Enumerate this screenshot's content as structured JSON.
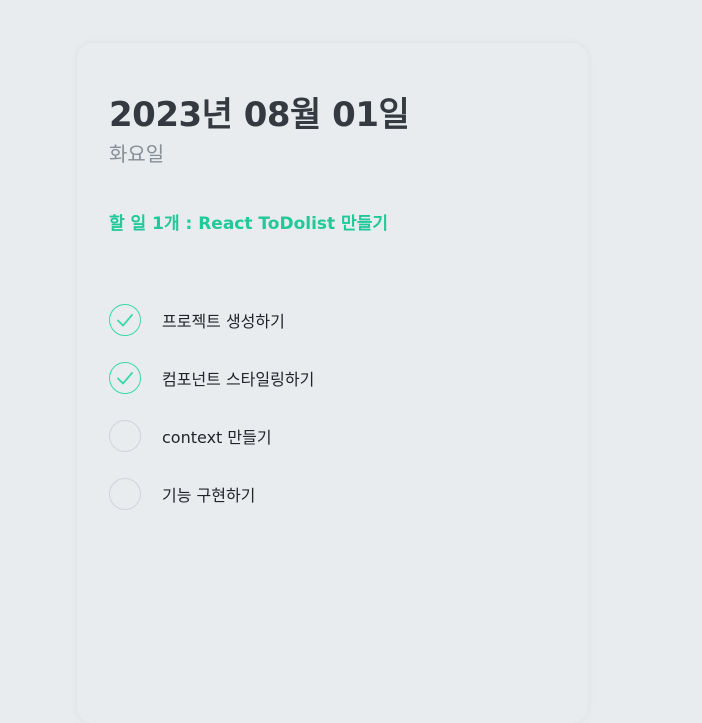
{
  "header": {
    "date": "2023년 08월 01일",
    "day": "화요일",
    "tasks_left": "할 일 1개 : React ToDolist 만들기"
  },
  "todos": [
    {
      "text": "프로젝트 생성하기",
      "done": true
    },
    {
      "text": "컴포넌트 스타일링하기",
      "done": true
    },
    {
      "text": "context 만들기",
      "done": false
    },
    {
      "text": "기능 구현하기",
      "done": false
    }
  ],
  "colors": {
    "accent": "#20c997",
    "check_done": "#38d9a9",
    "check_undone_border": "#ced4da",
    "title": "#343a40",
    "subtitle": "#868e96"
  },
  "icons": {
    "check": "check-icon"
  }
}
